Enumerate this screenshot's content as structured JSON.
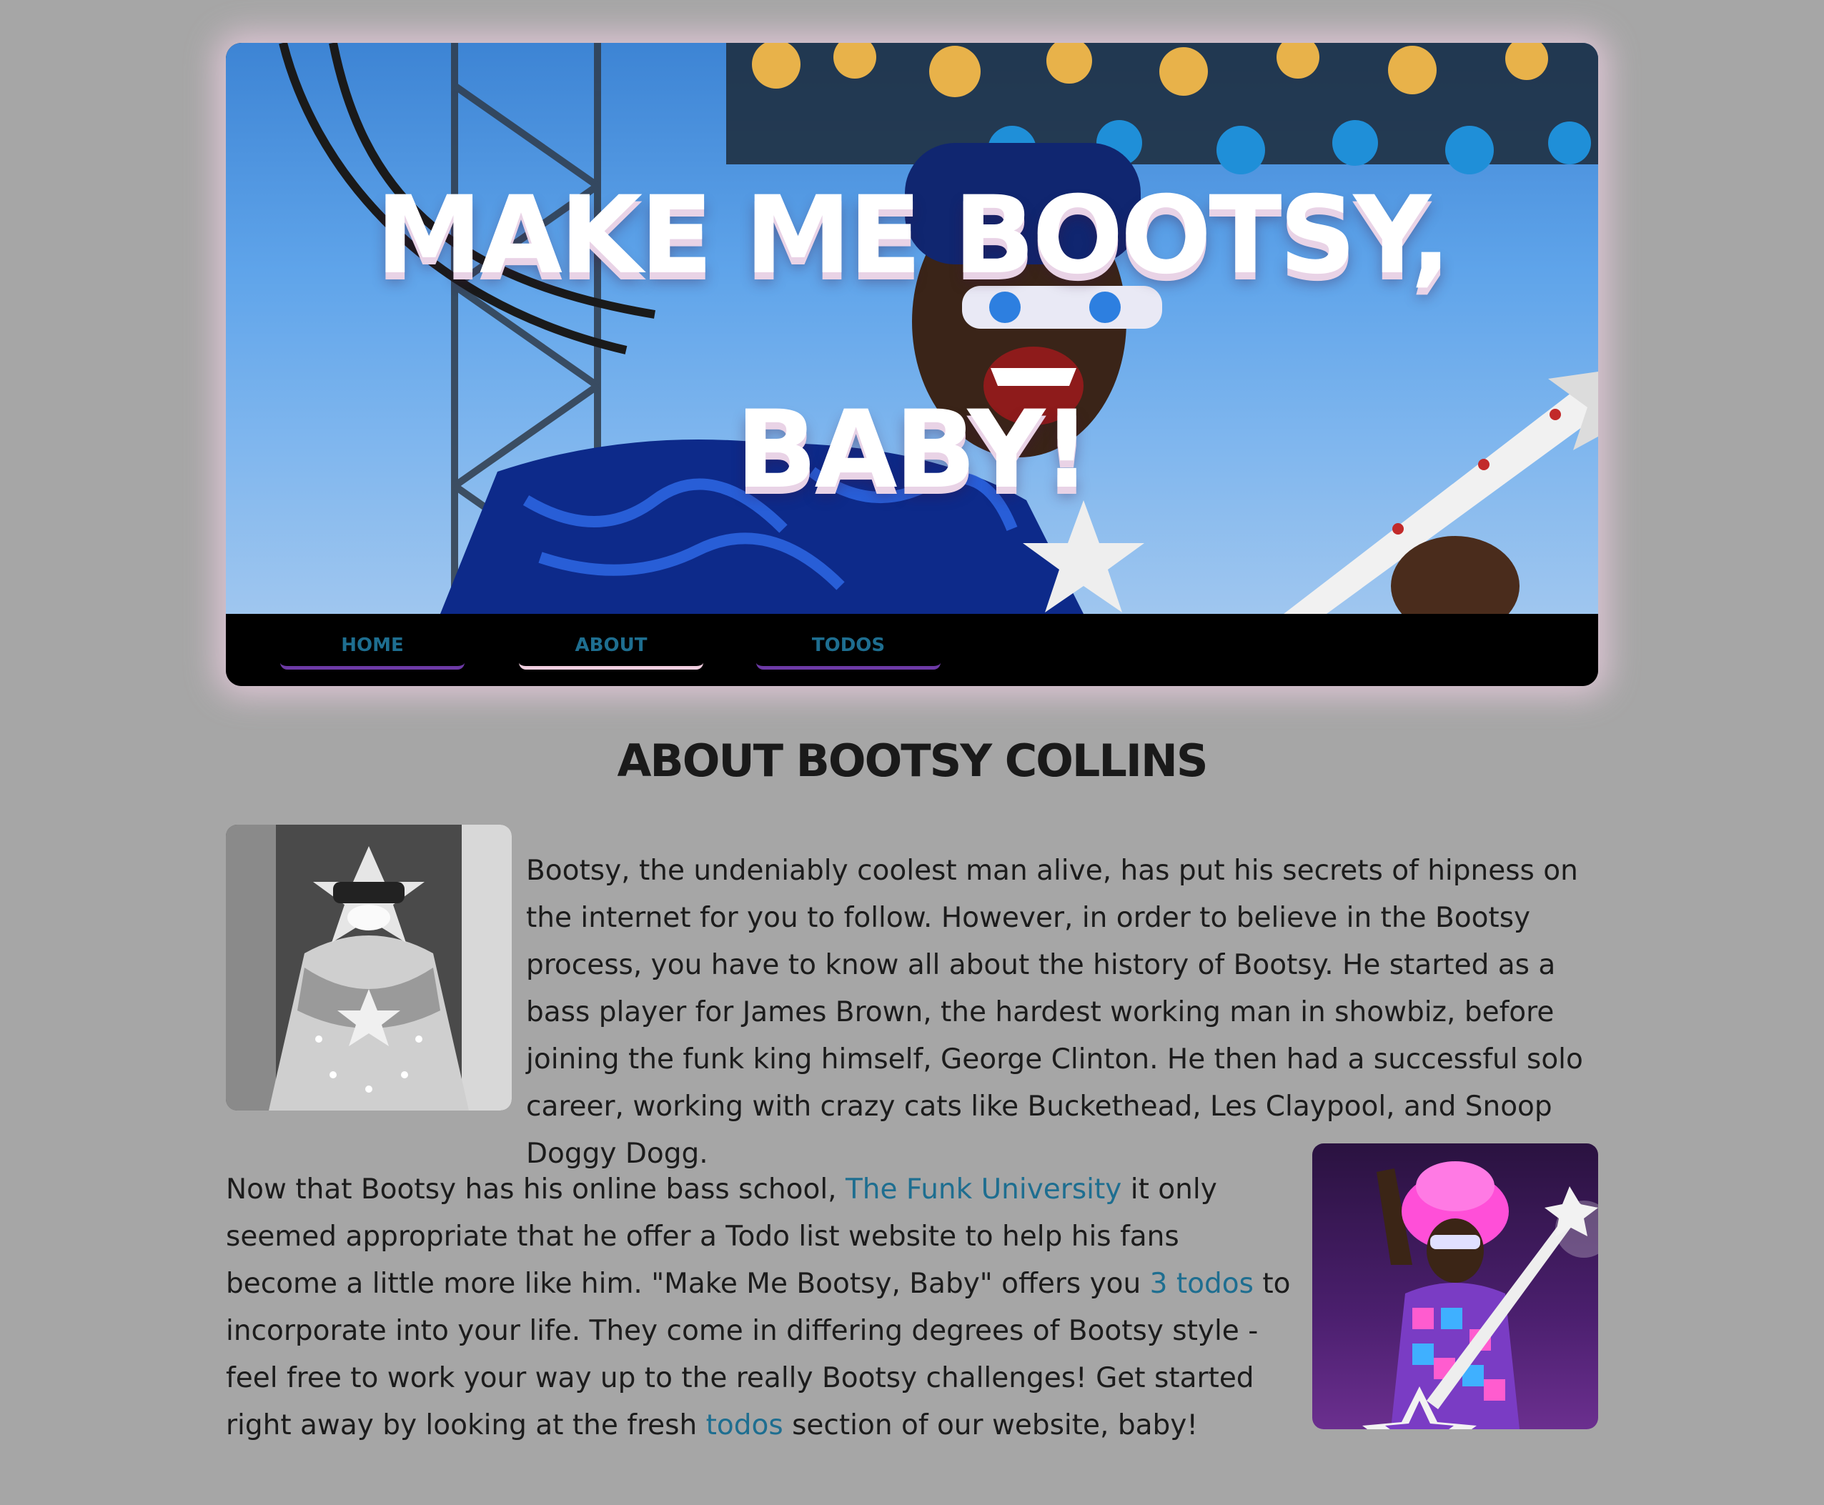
{
  "header": {
    "title": "Make Me Bootsy, Baby!",
    "hero_image": "bootsy-collins-performing-with-star-bass"
  },
  "nav": {
    "items": [
      {
        "label": "HOME",
        "active": false
      },
      {
        "label": "ABOUT",
        "active": true
      },
      {
        "label": "TODOS",
        "active": false
      }
    ]
  },
  "about": {
    "title": "About Bootsy Collins",
    "paragraph1": "Bootsy, the undeniably coolest man alive, has put his secrets of hipness on the internet for you to follow. However, in order to believe in the Bootsy process, you have to know all about the history of Bootsy. He started as a bass player for James Brown, the hardest working man in showbiz, before joining the funk king himself, George Clinton. He then had a successful solo career, working with crazy cats like Buckethead, Les Claypool, and Snoop Doggy Dogg.",
    "paragraph2": {
      "part1": "Now that Bootsy has his online bass school, ",
      "link1": "The Funk University",
      "part2": " it only seemed appropriate that he offer a Todo list website to help his fans become a little more like him. \"Make Me Bootsy, Baby\" offers you ",
      "link2": "3 todos",
      "part3": " to incorporate into your life. They come in differing degrees of Bootsy style - feel free to work your way up to the really Bootsy challenges! Get started right away by looking at the fresh ",
      "link3": "todos",
      "part4": " section of our website, baby!"
    },
    "photo1": "bootsy-black-and-white-star-costume",
    "photo2": "bootsy-pink-hat-star-bass-on-stage"
  },
  "colors": {
    "background": "#a6a6a6",
    "link": "#1e6e90",
    "nav_underline": "#6d3aa6",
    "nav_underline_active": "#f2cfe0",
    "header_glow": "#eecee2"
  }
}
